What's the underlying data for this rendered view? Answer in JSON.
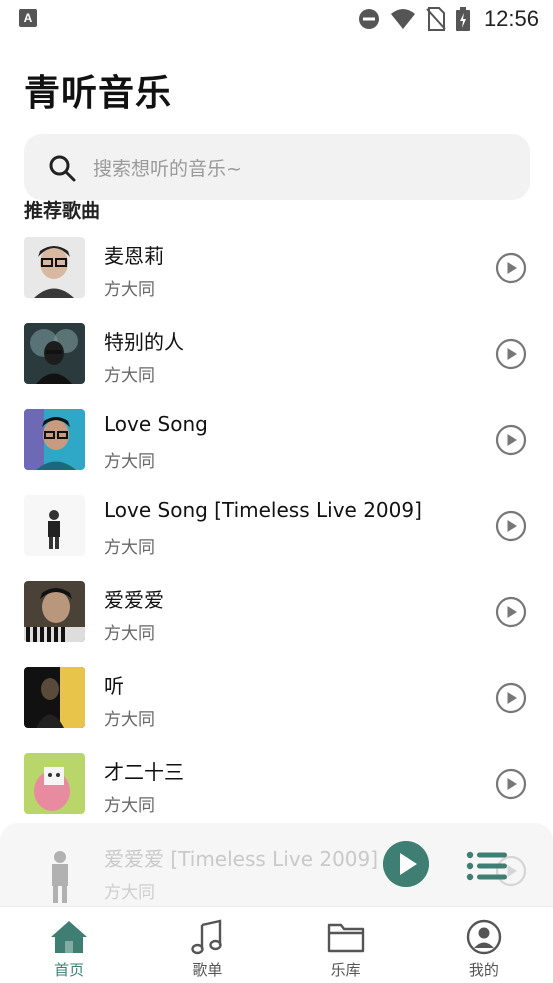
{
  "status_bar": {
    "left_icon": "A",
    "time": "12:56",
    "icons": [
      "do-not-disturb-icon",
      "wifi-icon",
      "no-sim-icon",
      "battery-charging-icon"
    ]
  },
  "app_title": "青听音乐",
  "search": {
    "placeholder": "搜索想听的音乐~"
  },
  "section_title": "推荐歌曲",
  "songs": [
    {
      "title": "麦恩莉",
      "artist": "方大同"
    },
    {
      "title": "特别的人",
      "artist": "方大同"
    },
    {
      "title": "Love Song",
      "artist": "方大同"
    },
    {
      "title": "Love Song [Timeless Live 2009]",
      "artist": "方大同"
    },
    {
      "title": "爱爱爱",
      "artist": "方大同"
    },
    {
      "title": "听",
      "artist": "方大同"
    },
    {
      "title": "才二十三",
      "artist": "方大同"
    }
  ],
  "mini_player": {
    "title": "爱爱爱 [Timeless Live 2009]",
    "artist": "方大同"
  },
  "nav": [
    {
      "label": "首页",
      "icon": "home-icon",
      "active": true
    },
    {
      "label": "歌单",
      "icon": "music-note-icon",
      "active": false
    },
    {
      "label": "乐库",
      "icon": "folder-icon",
      "active": false
    },
    {
      "label": "我的",
      "icon": "profile-icon",
      "active": false
    }
  ],
  "colors": {
    "accent": "#3f7f73",
    "inactive": "#555555",
    "search_bg": "#f2f2f2"
  }
}
